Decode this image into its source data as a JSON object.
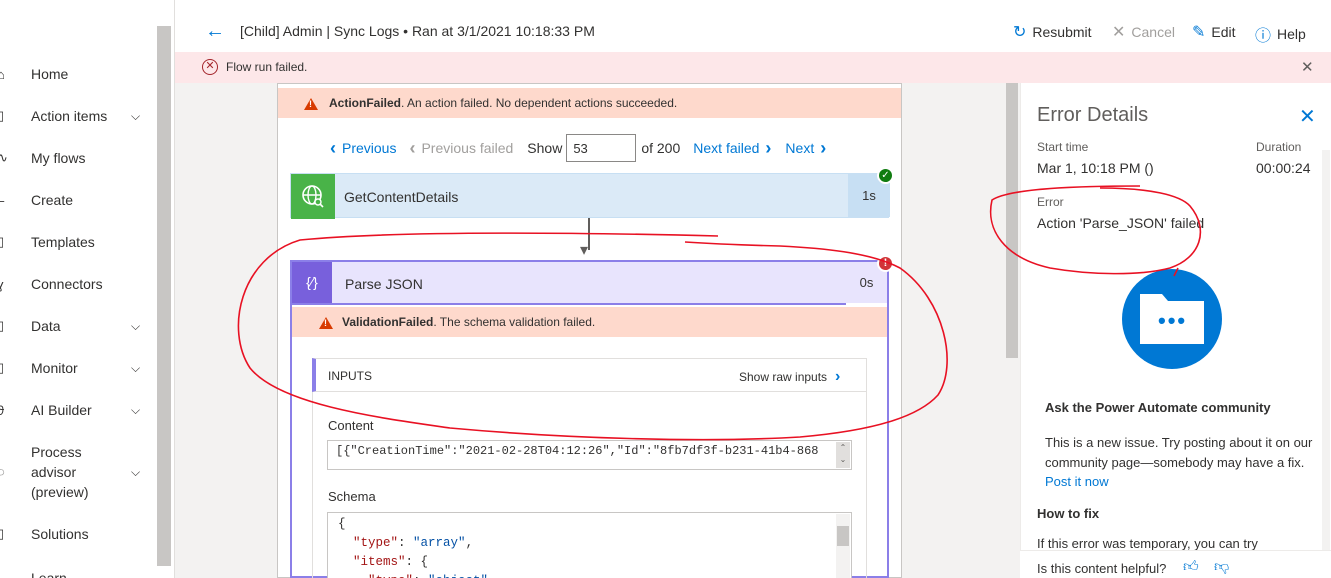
{
  "sidebar": {
    "items": [
      {
        "label": "Home",
        "icon": "home-icon",
        "chevron": false
      },
      {
        "label": "Action items",
        "icon": "clipboard-icon",
        "chevron": true
      },
      {
        "label": "My flows",
        "icon": "flow-icon",
        "chevron": false
      },
      {
        "label": "Create",
        "icon": "plus-icon",
        "chevron": false
      },
      {
        "label": "Templates",
        "icon": "template-icon",
        "chevron": false
      },
      {
        "label": "Connectors",
        "icon": "connector-icon",
        "chevron": false
      },
      {
        "label": "Data",
        "icon": "database-icon",
        "chevron": true
      },
      {
        "label": "Monitor",
        "icon": "monitor-icon",
        "chevron": true
      },
      {
        "label": "AI Builder",
        "icon": "ai-builder-icon",
        "chevron": true
      },
      {
        "label": "Process advisor (preview)",
        "icon": "process-advisor-icon",
        "chevron": true
      },
      {
        "label": "Solutions",
        "icon": "solutions-icon",
        "chevron": false
      },
      {
        "label": "Learn",
        "icon": "learn-icon",
        "chevron": false
      }
    ]
  },
  "header": {
    "title": "[Child] Admin | Sync Logs • Ran at 3/1/2021 10:18:33 PM",
    "resubmit": "Resubmit",
    "cancel": "Cancel",
    "edit": "Edit",
    "help": "Help"
  },
  "banner": {
    "text": "Flow run failed."
  },
  "action_failed": {
    "bold": "ActionFailed",
    "text": ". An action failed. No dependent actions succeeded."
  },
  "pager": {
    "previous": "Previous",
    "previous_failed": "Previous failed",
    "show": "Show",
    "page_value": "53",
    "of_total": "of 200",
    "next_failed": "Next failed",
    "next": "Next"
  },
  "steps": {
    "get_content": {
      "name": "GetContentDetails",
      "duration": "1s",
      "status": "succeeded"
    },
    "parse_json": {
      "name": "Parse JSON",
      "duration": "0s",
      "status": "failed",
      "error_bold": "ValidationFailed",
      "error_text": ". The schema validation failed."
    }
  },
  "inputs": {
    "header": "INPUTS",
    "show_raw": "Show raw inputs",
    "content_label": "Content",
    "content_value": "[{\"CreationTime\":\"2021-02-28T04:12:26\",\"Id\":\"8fb7df3f-b231-41b4-868",
    "schema_label": "Schema",
    "schema_lines": [
      "{",
      "  \"type\": \"array\",",
      "  \"items\": {",
      "    \"type\": \"object\","
    ]
  },
  "error_panel": {
    "title": "Error Details",
    "start_label": "Start time",
    "start_value": "Mar 1, 10:18 PM ()",
    "duration_label": "Duration",
    "duration_value": "00:00:24",
    "error_label": "Error",
    "error_value": "Action 'Parse_JSON' failed",
    "community_title": "Ask the Power Automate community",
    "community_text": "This is a new issue. Try posting about it on our community page—somebody may have a fix.",
    "post_link": "Post it now",
    "howto_title": "How to fix",
    "howto_text": "If this error was temporary, you can try",
    "helpful": "Is this content helpful?"
  },
  "colors": {
    "accent": "#0078d4",
    "error": "#a4262c",
    "parse_json_purple": "#8b7fe8",
    "success": "#107c10",
    "annotation_red": "#e81123"
  }
}
